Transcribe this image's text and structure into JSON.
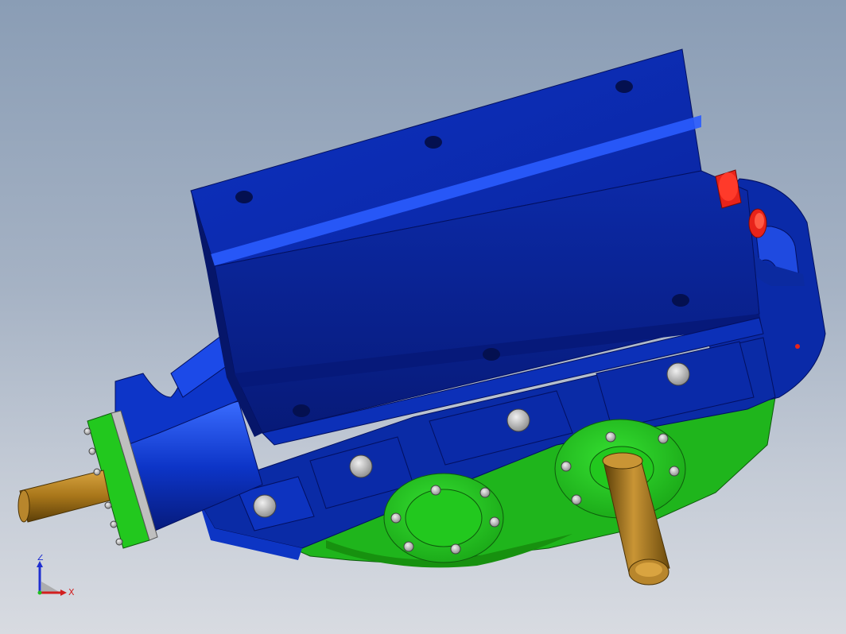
{
  "viewport": {
    "background_top": "#8a9db5",
    "background_bottom": "#d8dbe1"
  },
  "model": {
    "housing_color": "#0b2fb5",
    "base_color": "#22c81e",
    "shaft_color": "#a87b1e",
    "plug_color": "#e8231a",
    "bolt_color": "#b9b9b9"
  },
  "triad": {
    "z_label": "Z",
    "x_label": "X",
    "z_color": "#1f2fd0",
    "x_color": "#d21f1f"
  }
}
